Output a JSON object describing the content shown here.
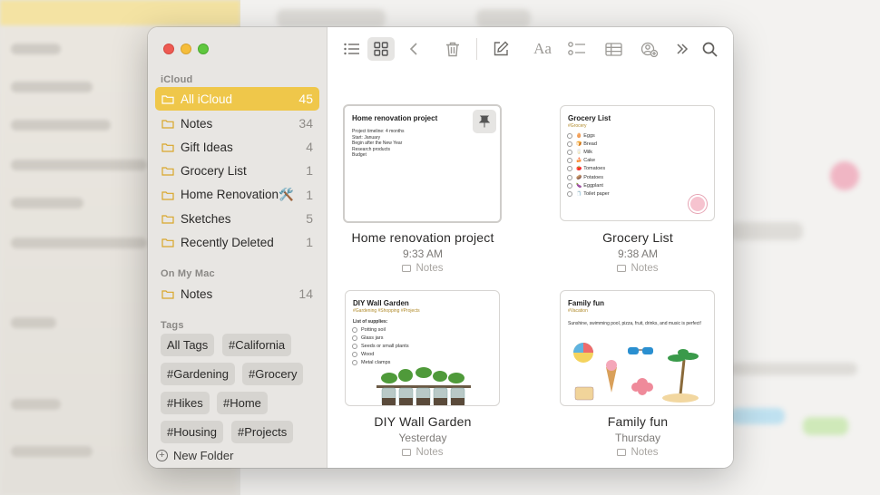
{
  "window": {
    "sections": {
      "icloud_label": "iCloud",
      "onmymac_label": "On My Mac",
      "tags_label": "Tags"
    },
    "icloud_folders": [
      {
        "name": "All iCloud",
        "count": "45"
      },
      {
        "name": "Notes",
        "count": "34"
      },
      {
        "name": "Gift Ideas",
        "count": "4"
      },
      {
        "name": "Grocery List",
        "count": "1"
      },
      {
        "name": "Home Renovation🛠️",
        "count": "1"
      },
      {
        "name": "Sketches",
        "count": "5"
      },
      {
        "name": "Recently Deleted",
        "count": "1"
      }
    ],
    "mac_folders": [
      {
        "name": "Notes",
        "count": "14"
      }
    ],
    "tags": [
      "All Tags",
      "#California",
      "#Gardening",
      "#Grocery",
      "#Hikes",
      "#Home",
      "#Housing",
      "#Projects"
    ],
    "new_folder_label": "New Folder"
  },
  "notes": [
    {
      "title": "Home renovation project",
      "time": "9:33 AM",
      "folder": "Notes",
      "preview_title": "Home renovation project",
      "preview_lines": [
        "Project timeline: 4 months",
        "Start: January",
        "Begin after the New Year",
        "Research products",
        "Budget"
      ]
    },
    {
      "title": "Grocery List",
      "time": "9:38 AM",
      "folder": "Notes",
      "preview_title": "Grocery List",
      "preview_sub": "#Grocery",
      "preview_items": [
        "Eggs",
        "Bread",
        "Milk",
        "Cake",
        "Tomatoes",
        "Potatoes",
        "Eggplant",
        "Toilet paper"
      ]
    },
    {
      "title": "DIY Wall Garden",
      "time": "Yesterday",
      "folder": "Notes",
      "preview_title": "DIY Wall Garden",
      "preview_sub": "#Gardening #Shopping #Projects",
      "preview_list_title": "List of supplies:",
      "preview_items": [
        "Potting soil",
        "Glass jars",
        "Seeds or small plants",
        "Wood",
        "Metal clamps"
      ]
    },
    {
      "title": "Family fun",
      "time": "Thursday",
      "folder": "Notes",
      "preview_title": "Family fun",
      "preview_sub": "#Vacation",
      "preview_body": "Sunshine, swimming pool, pizza, fruit, drinks, and music is perfect!"
    }
  ],
  "colors": {
    "accent": "#efc74a",
    "sidebar_bg": "#e8e6e3",
    "close": "#ee5a52",
    "minimize": "#f5bd3b",
    "zoom": "#5fc73e"
  }
}
